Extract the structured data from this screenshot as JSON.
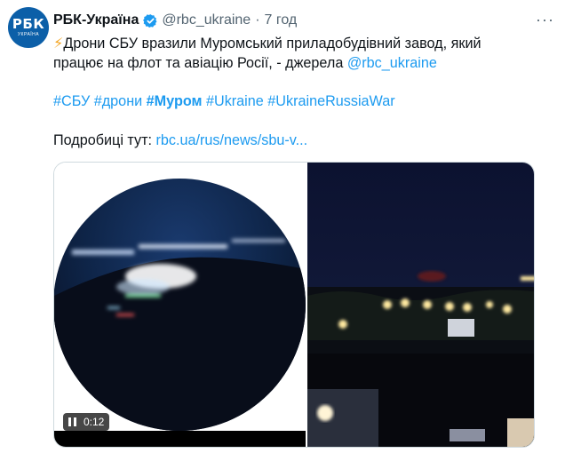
{
  "tweet": {
    "avatar_text": "РБК",
    "avatar_subtext": "УКРАЇНА",
    "display_name": "РБК-Україна",
    "handle": "@rbc_ukraine",
    "separator": "·",
    "time": "7 год",
    "more_label": "···",
    "bolt": "⚡",
    "line1_text": "Дрони СБУ вразили Муромський приладобудівний завод, який",
    "line2_text": "працює на флот та авіацію Росії, - джерела ",
    "mention": "@rbc_ukraine",
    "hashtags": [
      "#СБУ",
      "#дрони",
      "#Муром",
      "#Ukraine",
      "#UkraineRussiaWar"
    ],
    "details_label": "Подробиці тут: ",
    "details_link": "rbc.ua/rus/news/sbu-v..."
  },
  "video": {
    "time": "0:12",
    "state": "paused"
  },
  "colors": {
    "link": "#1d9bf0",
    "secondary": "#536471",
    "verified": "#1d9bf0",
    "brand": "#0c5fa8"
  }
}
